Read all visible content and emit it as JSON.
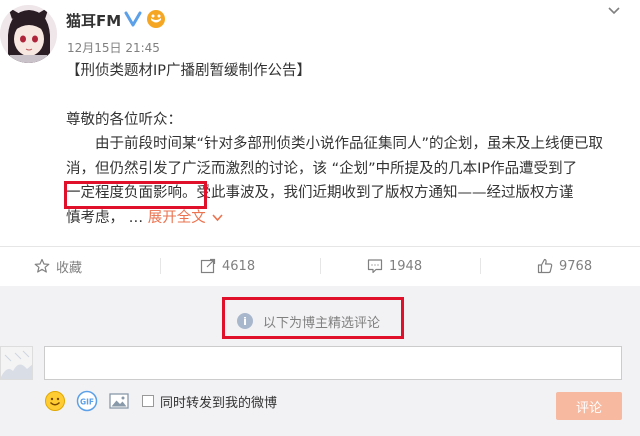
{
  "post": {
    "username": "猫耳FM",
    "timestamp": "12月15日 21:45",
    "title_line": "【刑侦类题材IP广播剧暂缓制作公告】",
    "greeting": "尊敬的各位听众：",
    "body_line1": "由于前段时间某“针对多部刑侦类小说作品征集同人”的企划，虽未及上线便已取",
    "body_line2": "消，但仍然引发了广泛而激烈的讨论，该 “企划”中所提及的几本IP作品遭受到了",
    "body_line3_highlight": "一定程度负面影响。",
    "body_line3_rest": "受此事波及，我们近期收到了版权方通知——经过版权方谨",
    "body_line4": "慎考虑，",
    "ellipsis": " … ",
    "expand_label": "展开全文"
  },
  "actions": {
    "favorite_label": "收藏",
    "repost_count": "4618",
    "comment_count": "1948",
    "like_count": "9768"
  },
  "comments": {
    "notice_text": "以下为博主精选评论",
    "repost_checkbox_label": "同时转发到我的微博",
    "submit_label": "评论"
  },
  "colors": {
    "accent": "#eb7350",
    "highlight_box": "#e0102a",
    "verify_badge": "#5ba0e8",
    "vip_badge": "#f5a623"
  },
  "icons": [
    "avatar",
    "verified-icon",
    "vip-icon",
    "chevron-down-icon",
    "star-icon",
    "repost-icon",
    "comment-icon",
    "like-icon",
    "info-icon",
    "emoji-icon",
    "gif-icon",
    "image-icon"
  ]
}
